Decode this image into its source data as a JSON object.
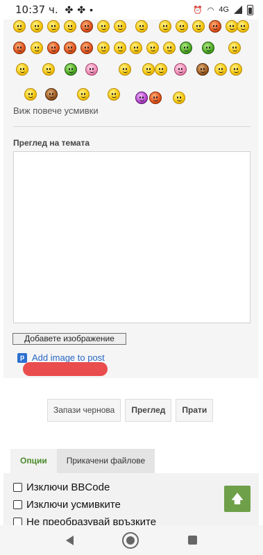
{
  "status_bar": {
    "time": "10:37 ч.",
    "network": "4G"
  },
  "smilies": {
    "more_label": "Виж повече усмивки"
  },
  "preview": {
    "label": "Преглед на темата"
  },
  "attach": {
    "add_image_button": "Добавете изображение",
    "postimage_link": "Add image to post",
    "postimage_icon_letter": "p"
  },
  "actions": {
    "save_draft": "Запази чернова",
    "preview": "Преглед",
    "submit": "Прати"
  },
  "tabs": {
    "options": "Опции",
    "attachments": "Прикачени файлове"
  },
  "options": {
    "disable_bbcode": "Изключи BBCode",
    "disable_smilies": "Изключи усмивките",
    "no_parse_urls": "Не преобразувай връзките"
  },
  "scroll_top": {
    "icon": "arrow-up-icon",
    "glyph": "🡅"
  },
  "colors": {
    "accent_green": "#6ea04a",
    "tab_active_text": "#4a8a2a",
    "link_blue": "#2867c4",
    "redaction_mark": "#ea4d4d"
  }
}
